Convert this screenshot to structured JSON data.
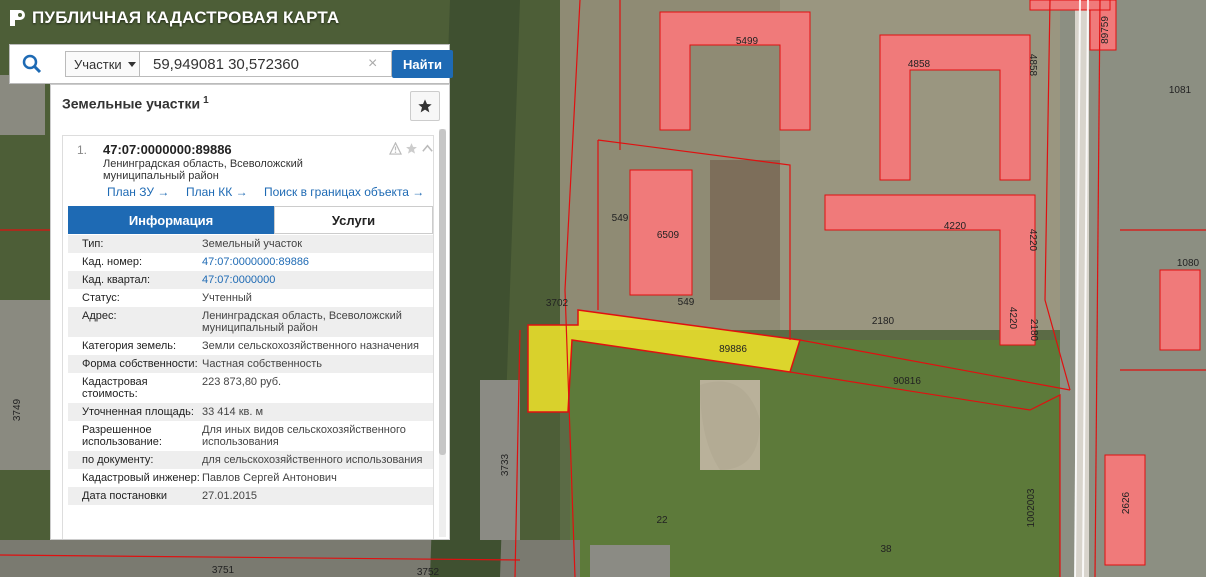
{
  "app": {
    "title": "ПУБЛИЧНАЯ КАДАСТРОВАЯ КАРТА"
  },
  "search": {
    "type_label": "Участки",
    "query": "59,949081 30,572360",
    "find_label": "Найти"
  },
  "panel": {
    "title": "Земельные участки",
    "count": "1",
    "item": {
      "index": "1.",
      "cad_number": "47:07:0000000:89886",
      "address": "Ленинградская область, Всеволожский муниципальный район",
      "links": [
        "План ЗУ →",
        "План КК →",
        "Поиск в границах объекта →"
      ]
    },
    "tabs": [
      "Информация",
      "Услуги"
    ],
    "attributes": [
      {
        "key": "Тип:",
        "value": "Земельный участок"
      },
      {
        "key": "Кад. номер:",
        "value": "47:07:0000000:89886",
        "link": true
      },
      {
        "key": "Кад. квартал:",
        "value": "47:07:0000000",
        "link": true
      },
      {
        "key": "Статус:",
        "value": "Учтенный"
      },
      {
        "key": "Адрес:",
        "value": "Ленинградская область, Всеволожский муниципальный район"
      },
      {
        "key": "Категория земель:",
        "value": "Земли сельскохозяйственного назначения"
      },
      {
        "key": "Форма собственности:",
        "value": "Частная собственность"
      },
      {
        "key": "Кадастровая стоимость:",
        "value": "223 873,80 руб."
      },
      {
        "key": "Уточненная площадь:",
        "value": "33 414 кв. м"
      },
      {
        "key": "Разрешенное использование:",
        "value": "Для иных видов сельскохозяйственного использования"
      },
      {
        "key": "по документу:",
        "value": "для сельскохозяйственного использования"
      },
      {
        "key": "Кадастровый инженер:",
        "value": "Павлов Сергей Антонович"
      },
      {
        "key": "Дата постановки",
        "value": "27.01.2015"
      }
    ]
  },
  "map": {
    "building_labels": [
      "5499",
      "4858",
      "4858",
      "1081",
      "89759",
      "549",
      "6509",
      "4220",
      "4220",
      "1080",
      "549",
      "3702",
      "2180",
      "2180",
      "4220",
      "89886",
      "90816",
      "3749",
      "3733",
      "22",
      "38",
      "1002003",
      "2626",
      "3751",
      "3752"
    ],
    "colors": {
      "building_fill": "#f07a7a",
      "parcel_border": "#e01010",
      "selected_fill": "#f2e52a",
      "accent": "#1e6ab4"
    }
  }
}
